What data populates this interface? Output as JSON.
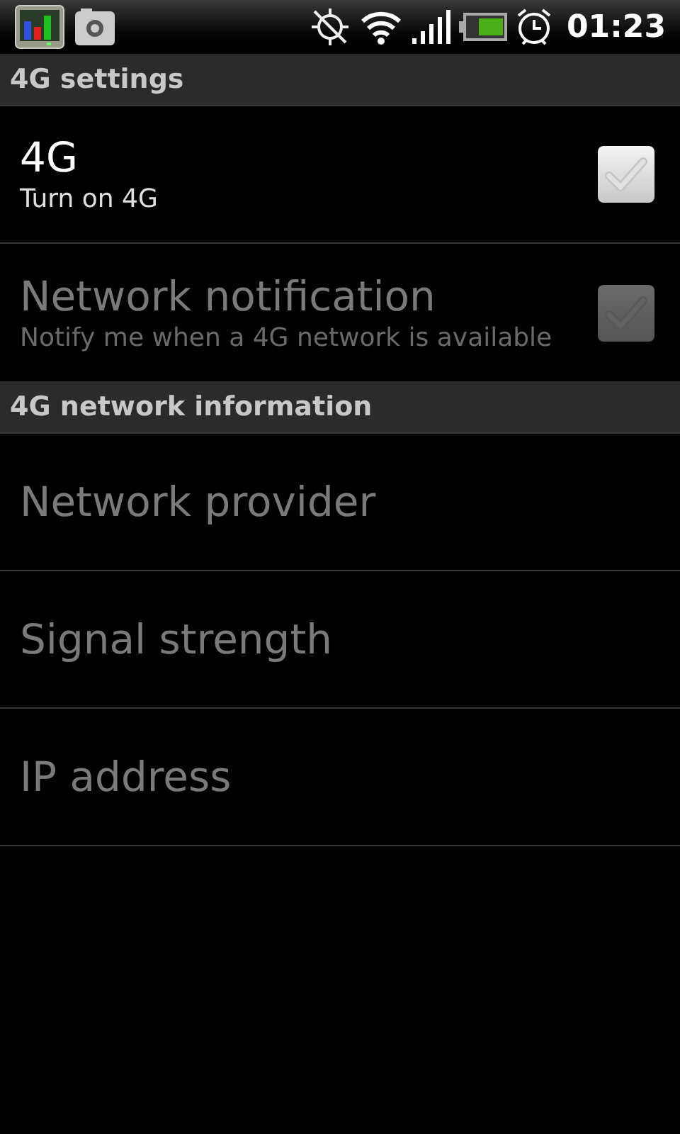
{
  "status_bar": {
    "time": "01:23"
  },
  "sections": [
    {
      "title": "4G settings",
      "items": [
        {
          "kind": "toggle",
          "title": "4G",
          "summary": "Turn on 4G",
          "checked": false,
          "disabled": false
        },
        {
          "kind": "toggle",
          "title": "Network notification",
          "summary": "Notify me when a 4G network is available",
          "checked": false,
          "disabled": true
        }
      ]
    },
    {
      "title": "4G network information",
      "items": [
        {
          "kind": "info",
          "title": "Network provider",
          "disabled": true
        },
        {
          "kind": "info",
          "title": "Signal strength",
          "disabled": true
        },
        {
          "kind": "info",
          "title": "IP address",
          "disabled": true
        }
      ]
    }
  ]
}
